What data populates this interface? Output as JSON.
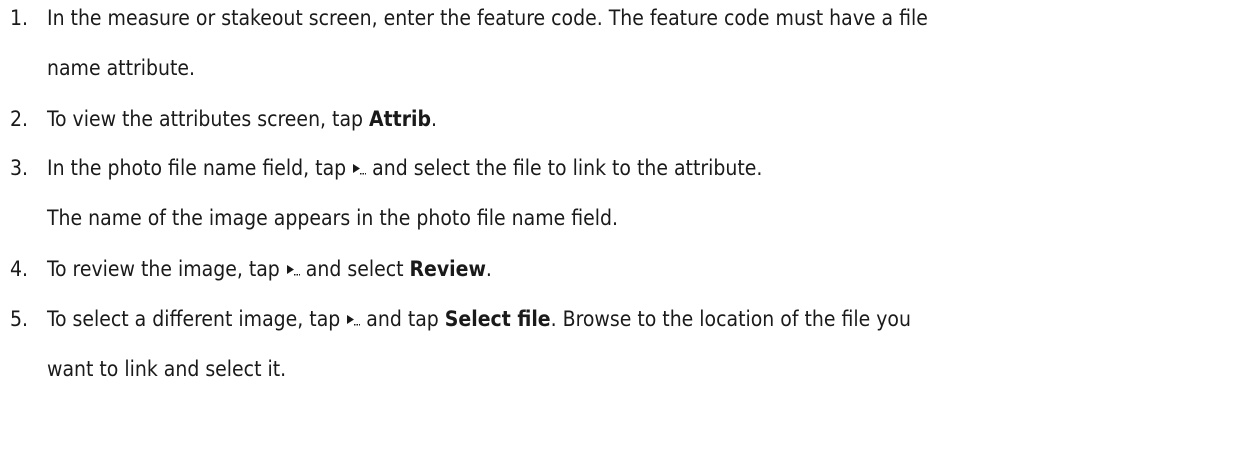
{
  "steps": [
    {
      "number": "1.",
      "lines": [
        "In the measure or stakeout screen, enter the feature code. The feature code must have a file",
        "name attribute."
      ]
    },
    {
      "number": "2.",
      "before": "To view the attributes screen, tap ",
      "bold": "Attrib",
      "after": "."
    },
    {
      "number": "3.",
      "before": "In the photo file name field, tap",
      "after": "and select the file to link to the attribute.",
      "note": "The name of the image appears in the photo file name field."
    },
    {
      "number": "4.",
      "before": "To review the image, tap",
      "middle": "and select ",
      "bold": "Review",
      "after": "."
    },
    {
      "number": "5.",
      "before": "To select a different image, tap",
      "middle": "and tap ",
      "bold": "Select file",
      "after": ". Browse to the location of the file you",
      "line2": "want to link and select it."
    }
  ],
  "icons": {
    "menu_arrow": "play-arrow-icon"
  }
}
